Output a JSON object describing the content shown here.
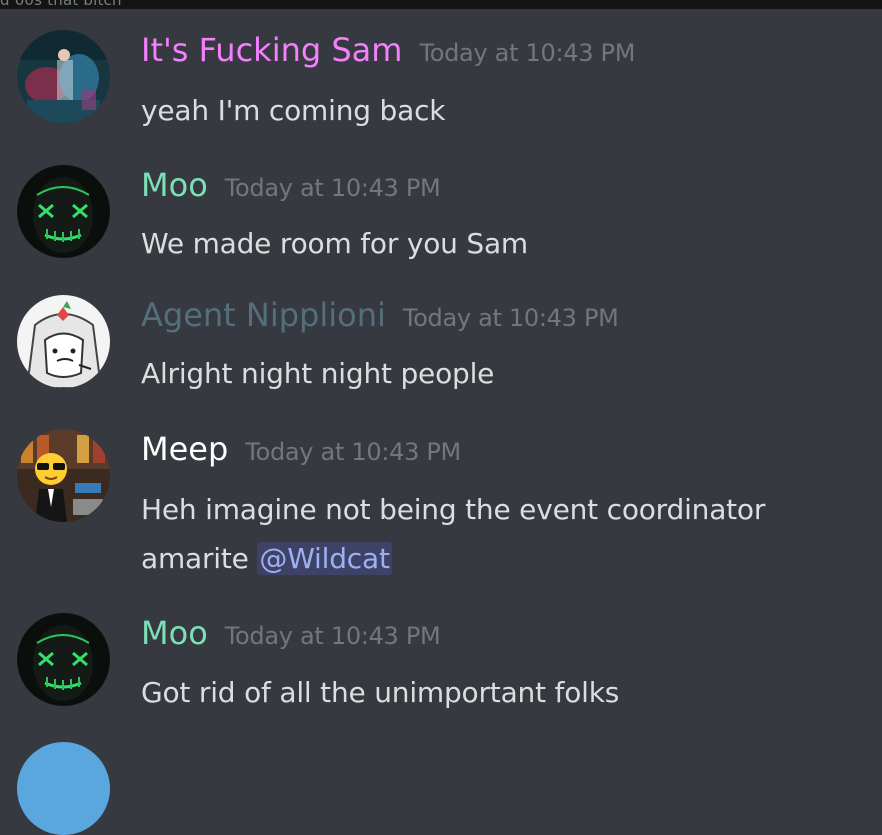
{
  "top_strip": {
    "text": "d 00s that bitch"
  },
  "colors": {
    "background": "#36393f",
    "text": "#dcddde",
    "timestamp": "#72767d",
    "mention_text": "#9fb0f2"
  },
  "messages": [
    {
      "username": "It's Fucking Sam",
      "username_color": "#f47fff",
      "timestamp": "Today at 10:43 PM",
      "text": "yeah I'm coming back",
      "avatar": "sam-avatar-icon"
    },
    {
      "username": "Moo",
      "username_color": "#7be0b4",
      "timestamp": "Today at 10:43 PM",
      "text": "We made room for you Sam",
      "avatar": "glowing-mask-avatar-icon"
    },
    {
      "username": "Agent Nipplioni",
      "username_color": "#546e7a",
      "timestamp": "Today at 10:43 PM",
      "text": "Alright night night people",
      "avatar": "cartoon-avatar-icon"
    },
    {
      "username": "Meep",
      "username_color": "#ffffff",
      "timestamp": "Today at 10:43 PM",
      "text_line1": "Heh imagine not being the event coordinator",
      "text_line2_prefix": "amarite ",
      "mention": "@Wildcat",
      "avatar": "sunglasses-emoji-avatar-icon"
    },
    {
      "username": "Moo",
      "username_color": "#7be0b4",
      "timestamp": "Today at 10:43 PM",
      "text": "Got rid of all the unimportant folks",
      "avatar": "glowing-mask-avatar-icon"
    }
  ]
}
